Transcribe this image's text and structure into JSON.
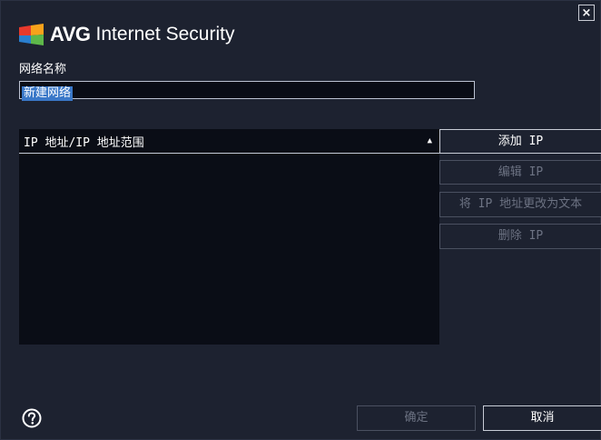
{
  "window": {
    "brand": "AVG",
    "product": "Internet Security",
    "close_glyph": "×",
    "close_icon": "close-icon"
  },
  "form": {
    "network_name_label": "网络名称",
    "network_name_value": "新建网络"
  },
  "ip_list": {
    "column_header": "IP 地址/IP 地址范围",
    "sort_glyph": "▲",
    "rows": []
  },
  "actions": {
    "add_ip": "添加 IP",
    "edit_ip": "编辑 IP",
    "change_to_text": "将 IP 地址更改为文本",
    "delete_ip": "删除 IP"
  },
  "footer": {
    "help_icon": "help-icon",
    "ok": "确定",
    "cancel": "取消"
  },
  "colors": {
    "background": "#1d2230",
    "list_background": "#0a0d16",
    "selection": "#3a78c8",
    "disabled_text": "#6c7282",
    "logo_red": "#e8392c",
    "logo_orange": "#f7a21b",
    "logo_green": "#5eb84a",
    "logo_blue": "#2a7fcf"
  }
}
